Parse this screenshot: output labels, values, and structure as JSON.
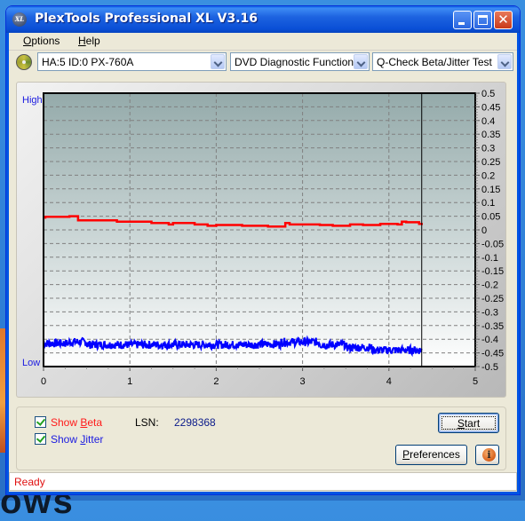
{
  "window": {
    "title": "PlexTools Professional XL V3.16",
    "app_icon_text": "XL",
    "controls": {
      "minimize": "minimize",
      "maximize": "maximize",
      "close": "✕"
    }
  },
  "menu": {
    "items": [
      {
        "label": "Options",
        "mnemonic": "O",
        "rest": "ptions"
      },
      {
        "label": "Help",
        "mnemonic": "H",
        "rest": "elp"
      }
    ]
  },
  "toolbar": {
    "drive_select": "HA:5 ID:0  PX-760A",
    "function_select": "DVD Diagnostic Functions",
    "test_select": "Q-Check Beta/Jitter Test"
  },
  "chart_data": {
    "type": "line",
    "title": "",
    "xlabel": "",
    "ylabel": "",
    "left_axis_labels": {
      "high": "High",
      "low": "Low"
    },
    "x_ticks": [
      "0",
      "1",
      "2",
      "3",
      "4",
      "5"
    ],
    "xlim": [
      0,
      5
    ],
    "y_ticks": [
      "0.5",
      "0.45",
      "0.4",
      "0.35",
      "0.3",
      "0.25",
      "0.2",
      "0.15",
      "0.1",
      "0.05",
      "0",
      "-0.05",
      "-0.1",
      "-0.15",
      "-0.2",
      "-0.25",
      "-0.3",
      "-0.35",
      "-0.4",
      "-0.45",
      "-0.5"
    ],
    "ylim": [
      -0.5,
      0.5
    ],
    "grid": true,
    "end_marker_x": 4.38,
    "colors": {
      "beta": "#ff0000",
      "jitter": "#0000ff",
      "frame": "#000000",
      "grid": "#808080"
    },
    "series": [
      {
        "name": "Beta",
        "x": [
          0,
          0.02,
          0.3,
          0.38,
          0.4,
          0.8,
          0.85,
          1.2,
          1.25,
          1.45,
          1.5,
          1.75,
          1.9,
          2.0,
          2.3,
          2.6,
          2.76,
          2.8,
          2.85,
          3.0,
          3.2,
          3.35,
          3.55,
          3.7,
          3.9,
          4.1,
          4.15,
          4.2,
          4.35,
          4.38
        ],
        "values": [
          0.045,
          0.048,
          0.05,
          0.05,
          0.035,
          0.035,
          0.03,
          0.03,
          0.025,
          0.02,
          0.025,
          0.02,
          0.015,
          0.018,
          0.015,
          0.012,
          0.012,
          0.025,
          0.02,
          0.02,
          0.018,
          0.015,
          0.02,
          0.018,
          0.022,
          0.02,
          0.03,
          0.028,
          0.022,
          0.025
        ]
      },
      {
        "name": "Jitter",
        "x": [
          0,
          0.3,
          0.5,
          1.0,
          1.5,
          2.0,
          2.5,
          2.75,
          2.9,
          3.2,
          3.5,
          3.8,
          4.0,
          4.2,
          4.38
        ],
        "values": [
          -0.415,
          -0.41,
          -0.42,
          -0.42,
          -0.42,
          -0.42,
          -0.418,
          -0.41,
          -0.41,
          -0.42,
          -0.43,
          -0.44,
          -0.44,
          -0.44,
          -0.44
        ],
        "noise": 0.015
      }
    ]
  },
  "options": {
    "show_beta": {
      "label_prefix": "Show ",
      "mnemonic": "B",
      "label_rest": "eta",
      "checked": true,
      "color": "#ff0000"
    },
    "show_jitter": {
      "label_prefix": "Show ",
      "mnemonic": "J",
      "label_rest": "itter",
      "checked": true,
      "color": "#0000ff"
    },
    "lsn_label": "LSN:",
    "lsn_value": "2298368"
  },
  "buttons": {
    "start": {
      "mnemonic": "S",
      "rest": "tart"
    },
    "preferences": {
      "mnemonic": "P",
      "rest": "references"
    },
    "info_glyph": "i"
  },
  "status": {
    "text": "Ready"
  },
  "desktop": {
    "partial_text": "ows"
  }
}
